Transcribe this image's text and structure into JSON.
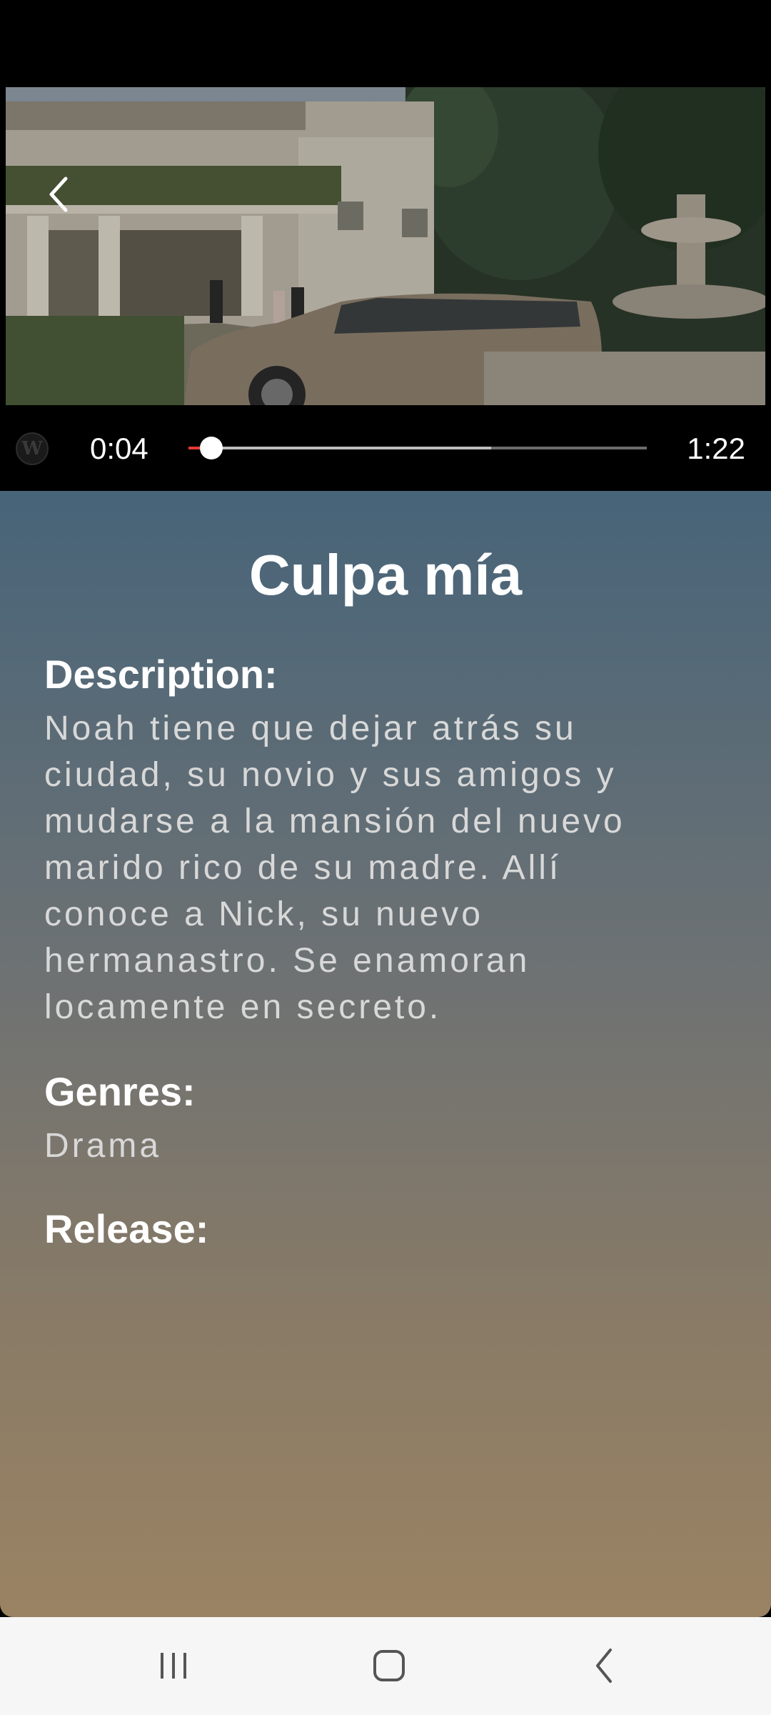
{
  "player": {
    "current_time": "0:04",
    "total_time": "1:22",
    "progress": 0.05,
    "buffered": 0.66
  },
  "movie": {
    "title": "Culpa mía",
    "description_label": "Description:",
    "description": "Noah tiene que dejar atrás su ciudad, su novio y sus amigos y mudarse a la mansión del nuevo marido rico de su madre. Allí conoce a Nick, su nuevo hermanastro. Se enamoran locamente en secreto.",
    "genres_label": "Genres:",
    "genres": "Drama",
    "release_label": "Release:"
  },
  "icons": {
    "back": "chevron-left-icon",
    "logo": "channel-logo-icon",
    "nav_recents": "recents-icon",
    "nav_home": "home-icon",
    "nav_back": "back-icon"
  }
}
